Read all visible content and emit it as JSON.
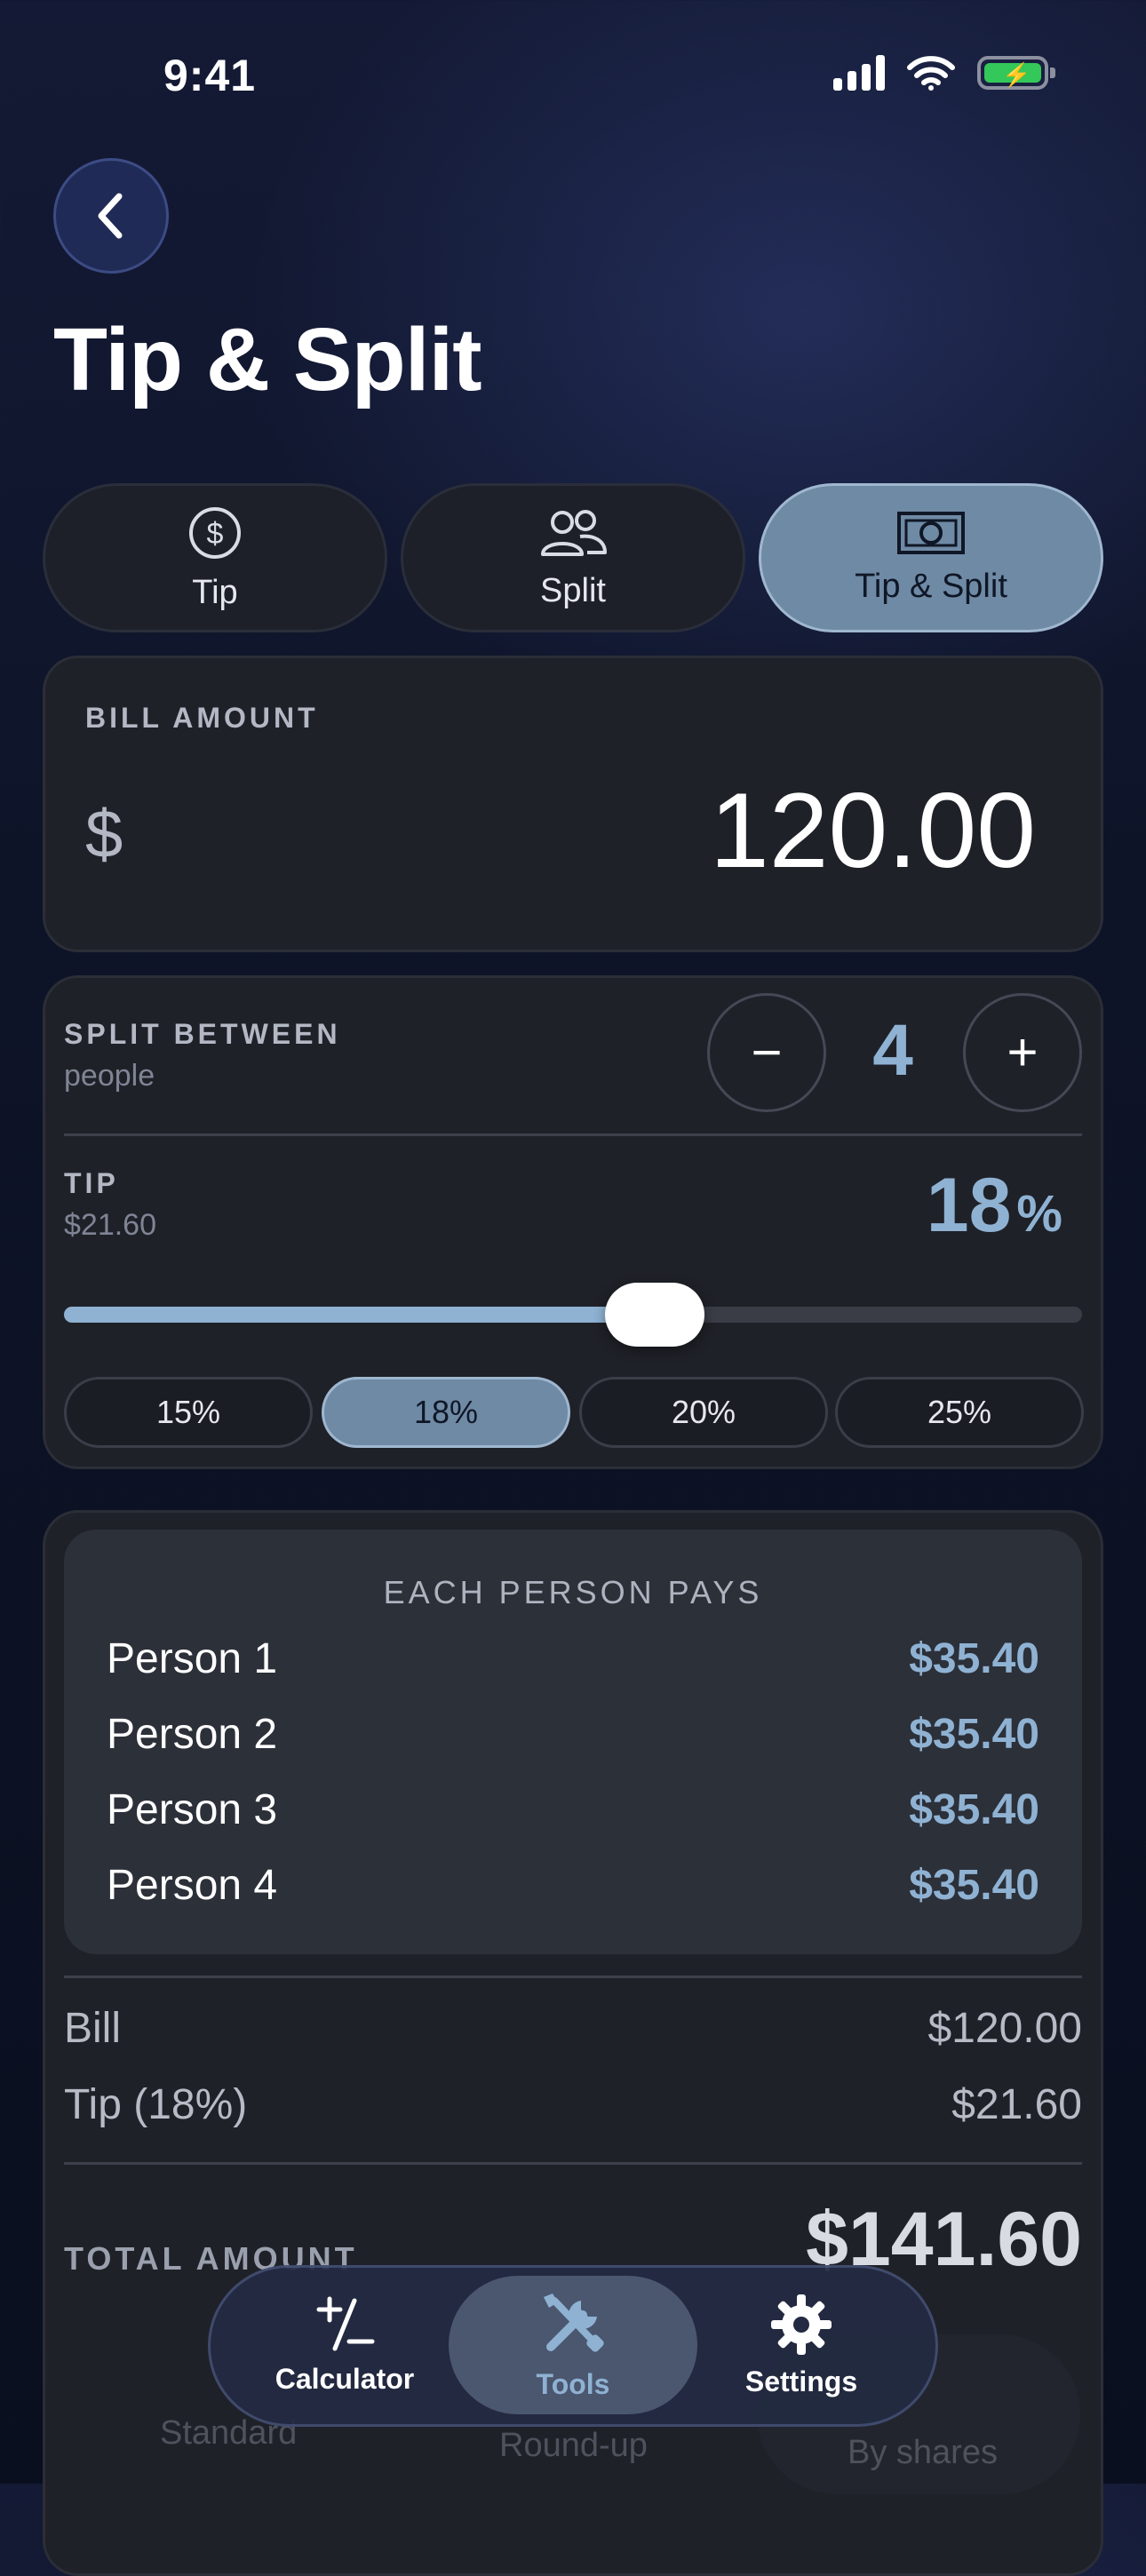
{
  "status_bar": {
    "time": "9:41"
  },
  "header": {
    "title": "Tip & Split"
  },
  "modes": [
    {
      "label": "Tip",
      "icon": "dollar-circle-icon",
      "active": false
    },
    {
      "label": "Split",
      "icon": "people-icon",
      "active": false
    },
    {
      "label": "Tip & Split",
      "icon": "banknote-icon",
      "active": true
    }
  ],
  "bill": {
    "label": "BILL AMOUNT",
    "currency": "$",
    "amount": "120.00"
  },
  "split": {
    "label": "SPLIT BETWEEN",
    "sublabel": "people",
    "count": "4",
    "minus": "−",
    "plus": "+"
  },
  "tip": {
    "label": "TIP",
    "amount": "$21.60",
    "percent": "18",
    "percent_sign": "%",
    "slider_fraction": 0.58,
    "presets": [
      {
        "label": "15%",
        "active": false
      },
      {
        "label": "18%",
        "active": true
      },
      {
        "label": "20%",
        "active": false
      },
      {
        "label": "25%",
        "active": false
      }
    ]
  },
  "results": {
    "title": "EACH PERSON PAYS",
    "people": [
      {
        "name": "Person 1",
        "amount": "$35.40"
      },
      {
        "name": "Person 2",
        "amount": "$35.40"
      },
      {
        "name": "Person 3",
        "amount": "$35.40"
      },
      {
        "name": "Person 4",
        "amount": "$35.40"
      }
    ],
    "bill_label": "Bill",
    "bill_value": "$120.00",
    "tip_label": "Tip (18%)",
    "tip_value": "$21.60",
    "total_label": "TOTAL AMOUNT",
    "total_value": "$141.60"
  },
  "rounding_options": [
    "Standard",
    "Round-up",
    "By shares"
  ],
  "tabbar": [
    {
      "label": "Calculator",
      "icon": "plus-minus-icon",
      "active": false
    },
    {
      "label": "Tools",
      "icon": "tools-icon",
      "active": true
    },
    {
      "label": "Settings",
      "icon": "gear-icon",
      "active": false
    }
  ],
  "colors": {
    "accent": "#8fb2d3",
    "active_chip": "#6f8aa5",
    "card": "#1f2128",
    "battery": "#34c759"
  }
}
